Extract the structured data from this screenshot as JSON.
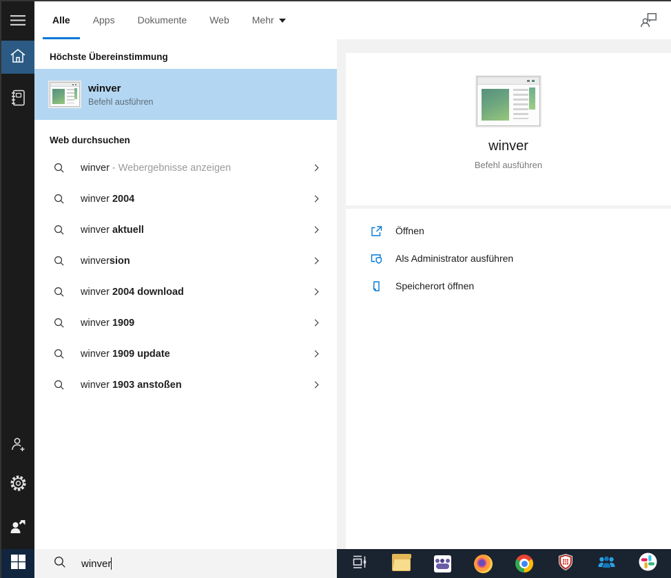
{
  "tabs": {
    "items": [
      {
        "label": "Alle",
        "active": true
      },
      {
        "label": "Apps",
        "active": false
      },
      {
        "label": "Dokumente",
        "active": false
      },
      {
        "label": "Web",
        "active": false
      },
      {
        "label": "Mehr",
        "active": false,
        "has_dropdown": true
      }
    ]
  },
  "sidebar": {
    "icons": [
      "menu-icon",
      "home-icon",
      "journal-icon",
      "add-user-icon",
      "settings-icon",
      "feedback-icon",
      "windows-start-icon"
    ]
  },
  "left_panel": {
    "section_top_match": "Höchste Übereinstimmung",
    "top_match": {
      "title": "winver",
      "subtitle": "Befehl ausführen"
    },
    "section_web": "Web durchsuchen",
    "suggestions": [
      {
        "typed": "winver",
        "bold": "",
        "note": " - Webergebnisse anzeigen"
      },
      {
        "typed": "winver ",
        "bold": "2004",
        "note": ""
      },
      {
        "typed": "winver ",
        "bold": "aktuell",
        "note": ""
      },
      {
        "typed": "winver",
        "bold": "sion",
        "note": ""
      },
      {
        "typed": "winver ",
        "bold": "2004 download",
        "note": ""
      },
      {
        "typed": "winver ",
        "bold": "1909",
        "note": ""
      },
      {
        "typed": "winver ",
        "bold": "1909 update",
        "note": ""
      },
      {
        "typed": "winver ",
        "bold": "1903 anstoßen",
        "note": ""
      }
    ]
  },
  "right_panel": {
    "app": {
      "title": "winver",
      "subtitle": "Befehl ausführen"
    },
    "actions": [
      {
        "label": "Öffnen",
        "icon": "open-icon"
      },
      {
        "label": "Als Administrator ausführen",
        "icon": "run-as-administrator-icon"
      },
      {
        "label": "Speicherort öffnen",
        "icon": "open-file-location-icon"
      }
    ]
  },
  "search_bar": {
    "value": "winver"
  },
  "taskbar": {
    "icons": [
      "task-view-icon",
      "file-explorer-icon",
      "teams-icon",
      "firefox-icon",
      "chrome-icon",
      "security-shield-icon",
      "contacts-app-icon",
      "slack-icon"
    ]
  },
  "colors": {
    "accent": "#0078d7",
    "selection": "#b3d7f2",
    "sidebar": "#1b1b1b",
    "taskbar": "#1a2330"
  }
}
